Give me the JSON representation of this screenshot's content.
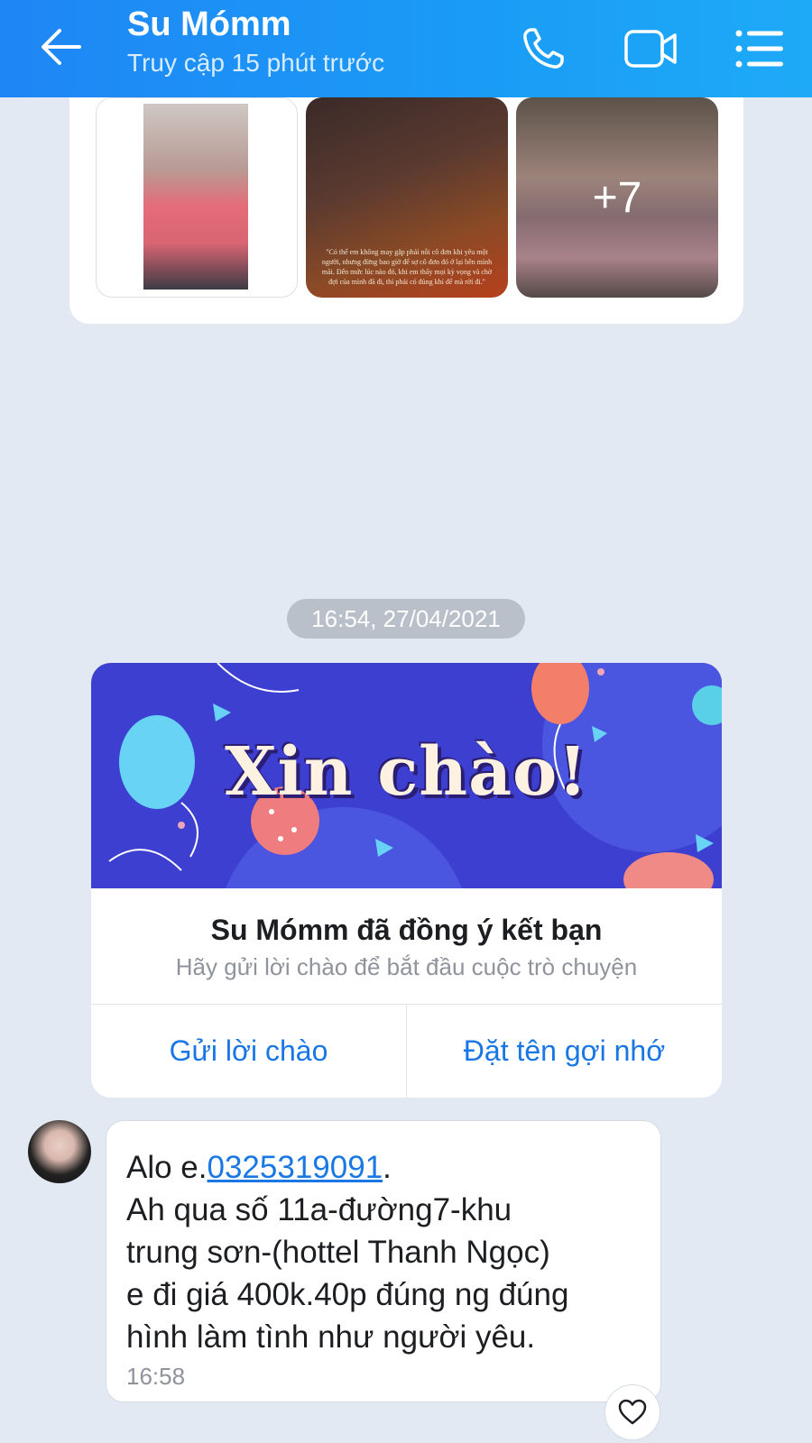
{
  "header": {
    "title": "Su Mómm",
    "status": "Truy cập 15 phút trước"
  },
  "photos": {
    "more_count": "+7",
    "quote_text": "\"Có thể em không may gặp phải nỗi cô đơn khi yêu một người, nhưng đừng bao giờ để sợ cô đơn đó ở lại bên mình mãi. Đến mức lúc nào đó, khi em thấy mọi kỳ vọng và chờ đợi của mình đã đi, thì phải có đủng khí để mà rời đi.\""
  },
  "timestamp": "16:54, 27/04/2021",
  "friend_card": {
    "banner_text": "Xin chào!",
    "title": "Su Mómm đã đồng ý kết bạn",
    "subtitle": "Hãy gửi lời chào để bắt đầu cuộc trò chuyện",
    "greet_button": "Gửi lời chào",
    "nickname_button": "Đặt tên gợi nhớ"
  },
  "message": {
    "prefix": "Alo e.",
    "phone": "0325319091",
    "after_phone": ".",
    "line2": "Ah qua số 11a-đường7-khu",
    "line3": "trung sơn-(hottel Thanh Ngọc)",
    "line4": "e đi giá 400k.40p đúng ng đúng",
    "line5": "hình làm tình như người yêu.",
    "time": "16:58"
  },
  "colors": {
    "header_blue": "#1f86f5",
    "link_blue": "#1976e5",
    "background": "#e2e9f2",
    "banner_purple": "#3c3fcf"
  },
  "icons": [
    "back-arrow-icon",
    "phone-icon",
    "video-camera-icon",
    "menu-list-icon",
    "heart-icon"
  ]
}
